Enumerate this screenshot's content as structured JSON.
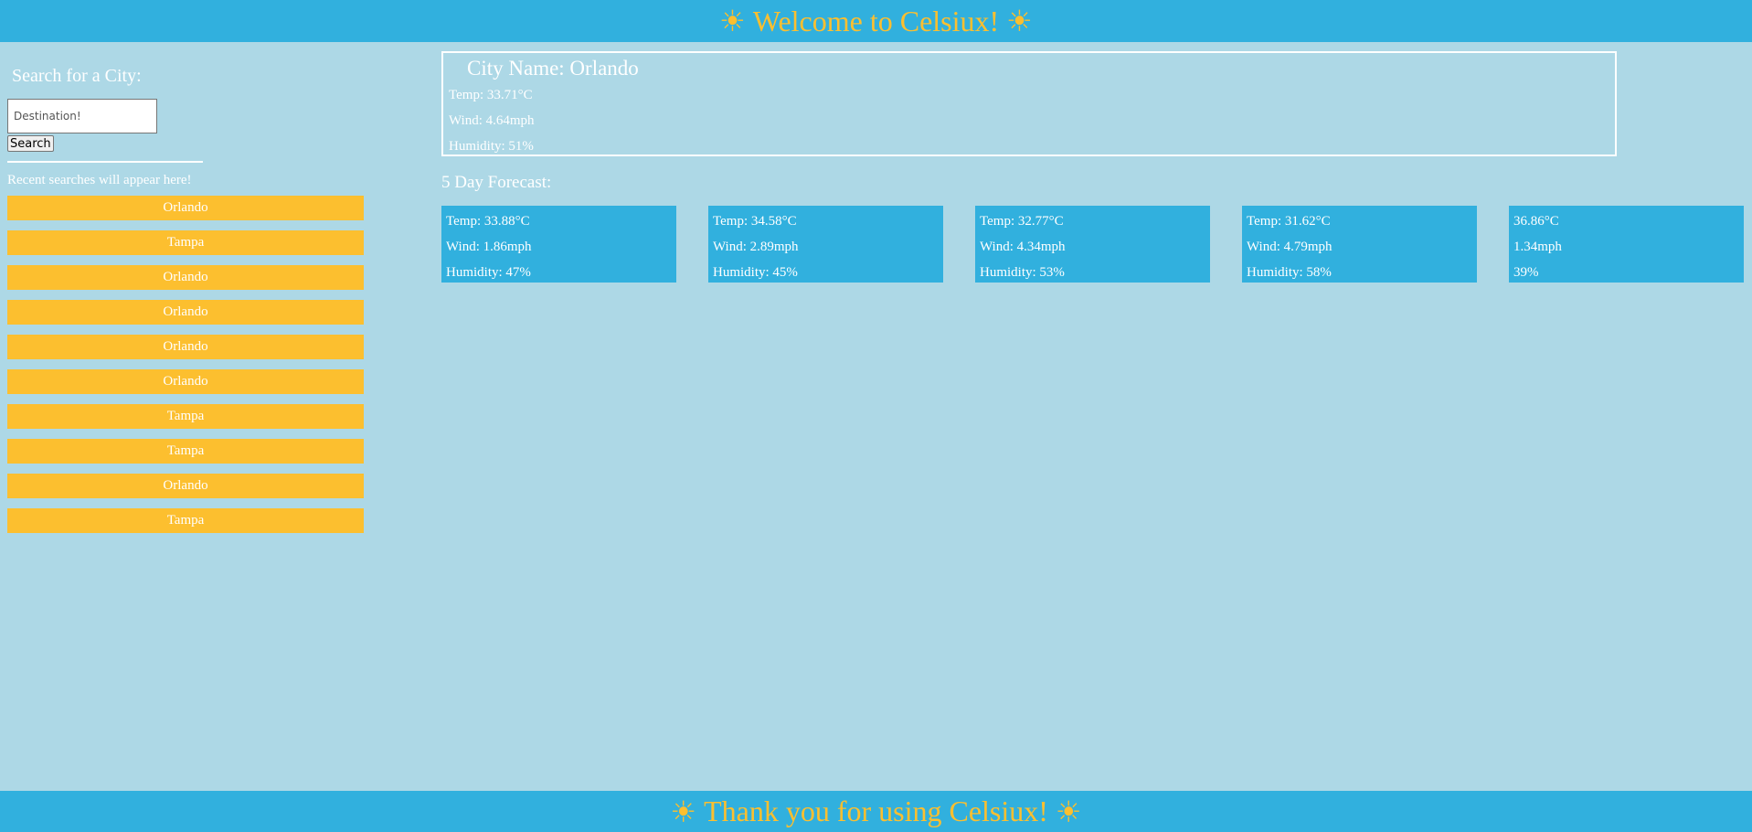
{
  "header": {
    "title": "Welcome to Celsiux!",
    "icon": "sun-icon",
    "icon_glyph": "☀"
  },
  "sidebar": {
    "search_label": "Search for a City:",
    "search_placeholder": "Destination!",
    "search_button": "Search",
    "recent_note": "Recent searches will appear here!",
    "recent": [
      "Orlando",
      "Tampa",
      "Orlando",
      "Orlando",
      "Orlando",
      "Orlando",
      "Tampa",
      "Tampa",
      "Orlando",
      "Tampa"
    ]
  },
  "current": {
    "city": "City Name: Orlando",
    "temp": "Temp: 33.71°C",
    "wind": "Wind: 4.64mph",
    "humidity": "Humidity: 51%"
  },
  "forecast": {
    "title": "5 Day Forecast:",
    "days": [
      {
        "temp": "Temp: 33.88°C",
        "wind": "Wind: 1.86mph",
        "humidity": "Humidity: 47%"
      },
      {
        "temp": "Temp: 34.58°C",
        "wind": "Wind: 2.89mph",
        "humidity": "Humidity: 45%"
      },
      {
        "temp": "Temp: 32.77°C",
        "wind": "Wind: 4.34mph",
        "humidity": "Humidity: 53%"
      },
      {
        "temp": "Temp: 31.62°C",
        "wind": "Wind: 4.79mph",
        "humidity": "Humidity: 58%"
      },
      {
        "temp": "36.86°C",
        "wind": "1.34mph",
        "humidity": "39%"
      }
    ]
  },
  "footer": {
    "text": "Thank you for using Celsiux!"
  },
  "colors": {
    "background": "#add8e6",
    "bar": "#31b0de",
    "accent": "#fcbf2f",
    "text": "#ffffff"
  }
}
